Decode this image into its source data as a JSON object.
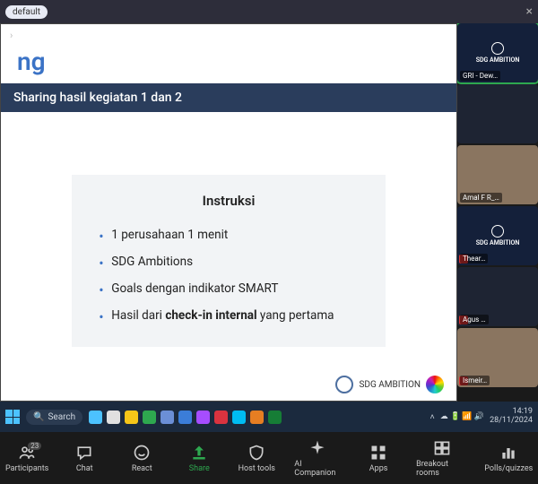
{
  "topbar": {
    "pill": "default"
  },
  "slide": {
    "breadcrumb": "›",
    "title_fragment": "ng",
    "bar": "Sharing hasil kegiatan 1 dan 2",
    "card_heading": "Instruksi",
    "bullets": [
      "1 perusahaan 1 menit",
      "SDG Ambitions",
      "Goals dengan indikator SMART",
      "Hasil dari check-in internal yang pertama"
    ],
    "footer_text": "SDG AMBITION"
  },
  "participants": [
    {
      "name": "GRI - Dew…",
      "style": "logo",
      "active": true,
      "logo": "SDG AMBITION"
    },
    {
      "name": "",
      "style": "dark"
    },
    {
      "name": "Amal F R_…",
      "style": "face"
    },
    {
      "name": "Thear…",
      "style": "logo",
      "muted": true,
      "logo": "SDG AMBITION"
    },
    {
      "name": "Agus …",
      "style": "dark",
      "muted": true
    },
    {
      "name": "Ismeir…",
      "style": "face",
      "muted": true
    }
  ],
  "taskbar": {
    "search": "Search",
    "icons": [
      "#4cc2ff",
      "#e0e0e0",
      "#f5c518",
      "#2ea84f",
      "#6b8fd6",
      "#3b7dd8",
      "#a64dff",
      "#d9333f",
      "#00bcf2",
      "#e67e22",
      "#167d36"
    ],
    "sys": [
      "☁",
      "🔋",
      "📶",
      "🔊"
    ],
    "time": "14:19",
    "date": "28/11/2024"
  },
  "controls": [
    {
      "label": "Participants",
      "icon": "people",
      "badge": "23"
    },
    {
      "label": "Chat",
      "icon": "chat"
    },
    {
      "label": "React",
      "icon": "smile"
    },
    {
      "label": "Share",
      "icon": "share",
      "green": true
    },
    {
      "label": "Host tools",
      "icon": "shield"
    },
    {
      "label": "AI Companion",
      "icon": "spark"
    },
    {
      "label": "Apps",
      "icon": "grid"
    },
    {
      "label": "Breakout rooms",
      "icon": "rooms"
    },
    {
      "label": "Polls/quizzes",
      "icon": "poll"
    }
  ]
}
